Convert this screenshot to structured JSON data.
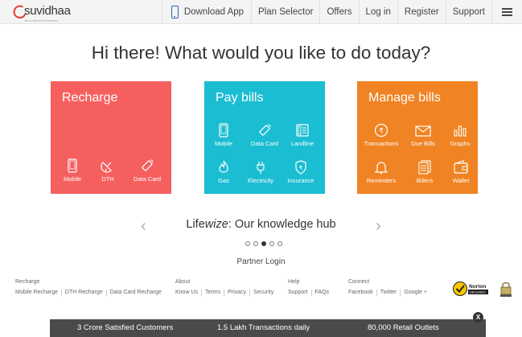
{
  "brand": {
    "name": "suvidhaa",
    "tagline": "Be a World of Services"
  },
  "nav": {
    "items": [
      "Download App",
      "Plan Selector",
      "Offers",
      "Log in",
      "Register",
      "Support"
    ]
  },
  "headline": "Hi there! What would you like to do today?",
  "tiles": {
    "recharge": {
      "title": "Recharge",
      "options": [
        "Mobile",
        "DTH",
        "Data Card"
      ]
    },
    "pay": {
      "title": "Pay bills",
      "options": [
        "Mobile",
        "Data Card",
        "Landline",
        "Gas",
        "Electricity",
        "Insurance"
      ]
    },
    "manage": {
      "title": "Manage bills",
      "options": [
        "Transactions",
        "Due Bills",
        "Graphs",
        "Reminders",
        "Billers",
        "Wallet"
      ]
    }
  },
  "hub": {
    "prefix": "Life",
    "italic": "wize",
    "suffix": ": Our knowledge hub"
  },
  "partner_login": "Partner Login",
  "footer": {
    "recharge": {
      "heading": "Recharge",
      "links": [
        "Mobile Recharge",
        "DTH Recharge",
        "Data Card Recharge"
      ]
    },
    "about": {
      "heading": "About",
      "links": [
        "Know Us",
        "Terms",
        "Privacy",
        "Security"
      ]
    },
    "help": {
      "heading": "Help",
      "links": [
        "Support",
        "FAQs"
      ]
    },
    "connect": {
      "heading": "Connect",
      "links": [
        "Facebook",
        "Twitter",
        "Google +"
      ]
    },
    "norton": {
      "name": "Norton",
      "sub": "SECURED"
    }
  },
  "stats": [
    "3 Crore Satisfied Customers",
    "1.5 Lakh Transactions daily",
    "80,000 Retail Outlets"
  ],
  "close_label": "X",
  "colors": {
    "recharge": "#f5605f",
    "pay": "#1bbdd3",
    "manage": "#f08323",
    "stats_bar": "#4a4a4a",
    "brand": "#e8392f"
  }
}
